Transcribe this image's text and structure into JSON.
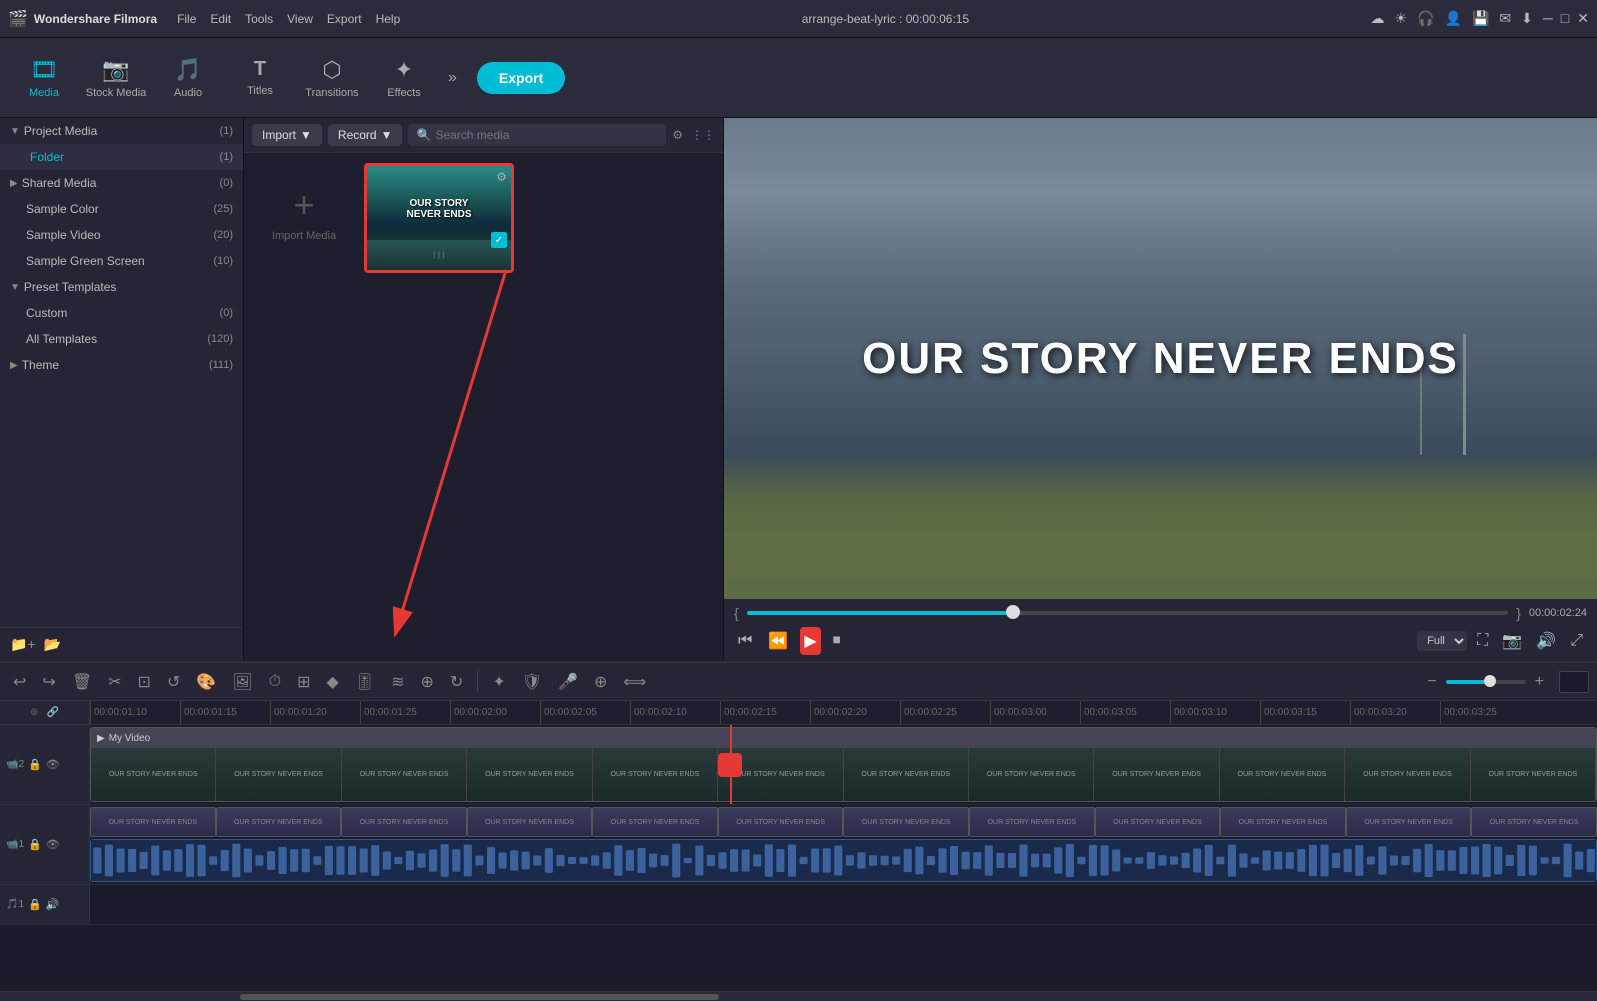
{
  "app": {
    "name": "Wondershare Filmora",
    "title": "arrange-beat-lyric : 00:00:06:15",
    "icon": "🎬"
  },
  "menu": {
    "items": [
      "File",
      "Edit",
      "Tools",
      "View",
      "Export",
      "Help"
    ]
  },
  "toolbar": {
    "buttons": [
      {
        "id": "media",
        "label": "Media",
        "icon": "🎞",
        "active": true
      },
      {
        "id": "stock-media",
        "label": "Stock Media",
        "icon": "📷",
        "active": false
      },
      {
        "id": "audio",
        "label": "Audio",
        "icon": "🎵",
        "active": false
      },
      {
        "id": "titles",
        "label": "Titles",
        "icon": "T",
        "active": false
      },
      {
        "id": "transitions",
        "label": "Transitions",
        "icon": "⬡",
        "active": false
      },
      {
        "id": "effects",
        "label": "Effects",
        "icon": "✦",
        "active": false
      }
    ],
    "export_label": "Export"
  },
  "left_panel": {
    "project_media": {
      "label": "Project Media",
      "count": "(1)"
    },
    "folder": {
      "label": "Folder",
      "count": "(1)"
    },
    "shared_media": {
      "label": "Shared Media",
      "count": "(0)"
    },
    "sample_color": {
      "label": "Sample Color",
      "count": "(25)"
    },
    "sample_video": {
      "label": "Sample Video",
      "count": "(20)"
    },
    "sample_green_screen": {
      "label": "Sample Green Screen",
      "count": "(10)"
    },
    "preset_templates": {
      "label": "Preset Templates",
      "count": ""
    },
    "custom": {
      "label": "Custom",
      "count": "(0)"
    },
    "all_templates": {
      "label": "All Templates",
      "count": "(120)"
    },
    "theme": {
      "label": "Theme",
      "count": "(111)"
    }
  },
  "media_toolbar": {
    "import_label": "Import",
    "record_label": "Record",
    "search_placeholder": "Search media"
  },
  "media_item": {
    "title": "OUR STORY NEVER ENDS",
    "label": "My Video",
    "play_icon": "▶"
  },
  "import_area": {
    "label": "Import Media"
  },
  "preview": {
    "title": "OUR STORY NEVER ENDS",
    "timestamp": "00:00:02:24",
    "quality": "Full",
    "time_bracket_left": "{",
    "time_bracket_right": "}"
  },
  "timeline": {
    "ruler_marks": [
      "00:00:01:10",
      "00:00:01:15",
      "00:00:01:20",
      "00:00:01:25",
      "00:00:02:00",
      "00:00:02:05",
      "00:00:02:10",
      "00:00:02:15",
      "00:00:02:20",
      "00:00:02:25",
      "00:00:03:00",
      "00:00:03:05",
      "00:00:03:10",
      "00:00:03:15",
      "00:00:03:20",
      "00:00:03:25"
    ],
    "video_track": {
      "track_num": "2",
      "label": "My Video",
      "segments": [
        "OUR STORY NEVER ENDS",
        "OUR STORY NEVER ENDS",
        "OUR STORY NEVER ENDS",
        "OUR STORY NEVER ENDS",
        "OUR STORY NEVER ENDS",
        "OUR STORY NEVER ENDS",
        "OUR STORY NEVER ENDS",
        "OUR STORY NEVER ENDS",
        "OUR STORY NEVER ENDS",
        "OUR STORY NEVER ENDS",
        "OUR STORY NEVER ENDS",
        "OUR STORY NEVER ENDS"
      ]
    },
    "audio_track": {
      "track_num": "1"
    },
    "music_track": {
      "track_num": "1"
    }
  },
  "win_controls": {
    "minimize": "─",
    "maximize": "□",
    "close": "✕"
  }
}
